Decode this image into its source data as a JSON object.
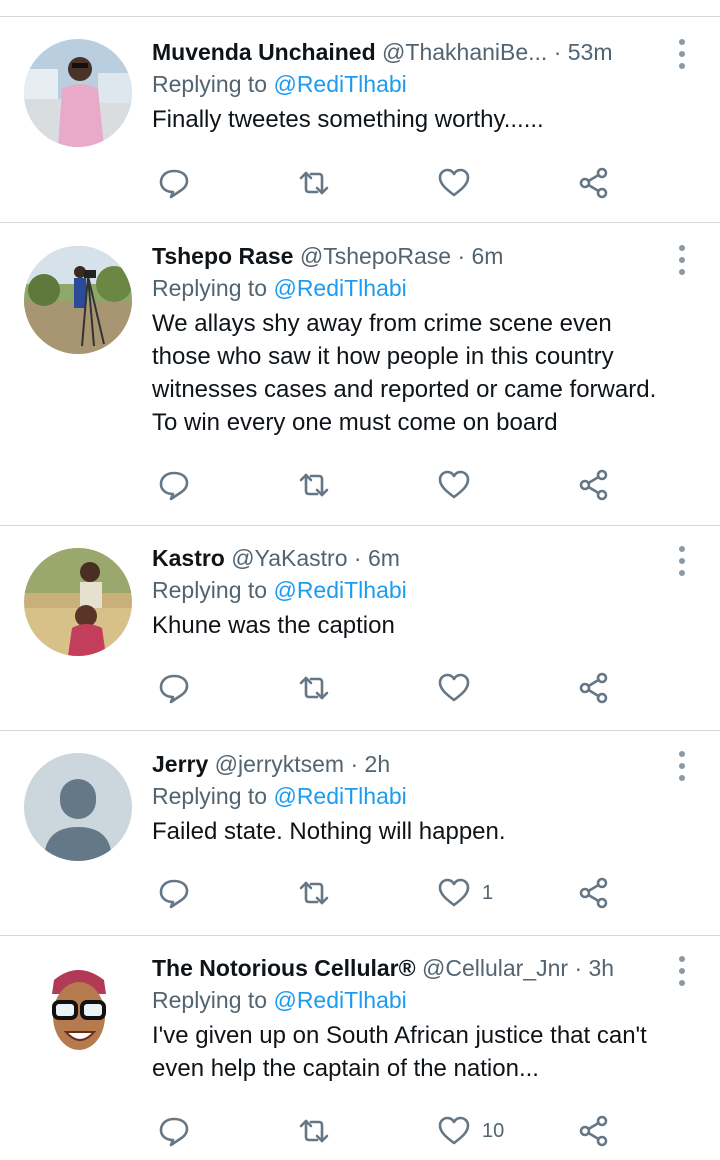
{
  "colors": {
    "accent": "#1d9bf0",
    "text": "#0f1419",
    "muted": "#536471",
    "icon": "#657786"
  },
  "tweets": [
    {
      "name": "Muvenda Unchained",
      "handle": "@ThakhaniBe...",
      "time": "· 53m",
      "replying_label": "Replying to",
      "replying_to": "@RediTlhabi",
      "text": "Finally tweetes something worthy......",
      "likes": ""
    },
    {
      "name": "Tshepo Rase",
      "handle": "@TshepoRase",
      "time": "· 6m",
      "replying_label": "Replying to",
      "replying_to": "@RediTlhabi",
      "text": "We allays shy away from crime scene even those who saw it how people in this country witnesses cases and reported or came forward. To win every one must come on board",
      "likes": ""
    },
    {
      "name": "Kastro",
      "handle": "@YaKastro",
      "time": "· 6m",
      "replying_label": "Replying to",
      "replying_to": "@RediTlhabi",
      "text": "Khune was the caption",
      "likes": ""
    },
    {
      "name": "Jerry",
      "handle": "@jerryktsem",
      "time": "· 2h",
      "replying_label": "Replying to",
      "replying_to": "@RediTlhabi",
      "text": "Failed state. Nothing will happen.",
      "likes": "1"
    },
    {
      "name": "The Notorious Cellular®",
      "handle": "@Cellular_Jnr",
      "time": "· 3h",
      "replying_label": "Replying to",
      "replying_to": "@RediTlhabi",
      "text": "I've given up on South African justice that can't even help the captain of the nation...",
      "likes": "10"
    }
  ],
  "icons": {
    "reply": "reply-icon",
    "retweet": "retweet-icon",
    "like": "like-icon",
    "share": "share-icon",
    "more": "more-icon"
  }
}
